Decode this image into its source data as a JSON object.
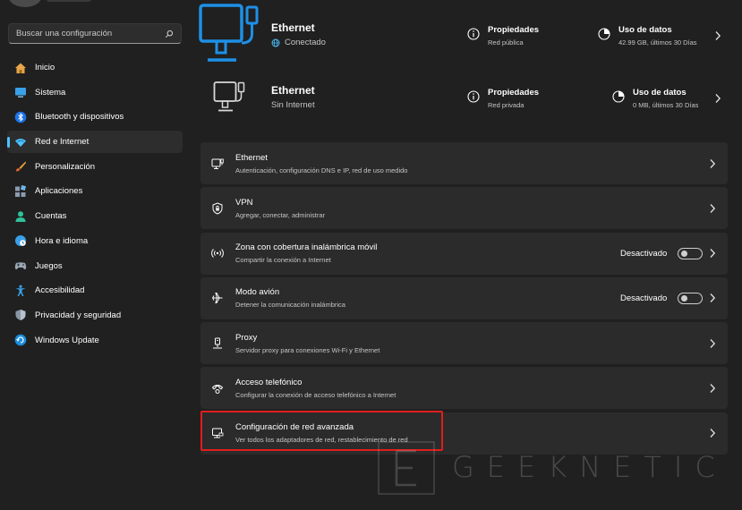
{
  "search": {
    "placeholder": "Buscar una configuración"
  },
  "sidebar": {
    "items": [
      {
        "label": "Inicio",
        "icon": "home-icon"
      },
      {
        "label": "Sistema",
        "icon": "system-icon"
      },
      {
        "label": "Bluetooth y dispositivos",
        "icon": "bluetooth-icon"
      },
      {
        "label": "Red e Internet",
        "icon": "network-icon",
        "active": true
      },
      {
        "label": "Personalización",
        "icon": "brush-icon"
      },
      {
        "label": "Aplicaciones",
        "icon": "apps-icon"
      },
      {
        "label": "Cuentas",
        "icon": "account-icon"
      },
      {
        "label": "Hora e idioma",
        "icon": "clock-globe-icon"
      },
      {
        "label": "Juegos",
        "icon": "gamepad-icon"
      },
      {
        "label": "Accesibilidad",
        "icon": "accessibility-icon"
      },
      {
        "label": "Privacidad y seguridad",
        "icon": "shield-icon"
      },
      {
        "label": "Windows Update",
        "icon": "update-icon"
      }
    ]
  },
  "networks": [
    {
      "name": "Ethernet",
      "status": "Conectado",
      "properties_title": "Propiedades",
      "properties_sub": "Red pública",
      "usage_title": "Uso de datos",
      "usage_sub": "42.99 GB, últimos 30 Días"
    },
    {
      "name": "Ethernet",
      "status": "Sin Internet",
      "properties_title": "Propiedades",
      "properties_sub": "Red privada",
      "usage_title": "Uso de datos",
      "usage_sub": "0 MB, últimos 30 Días"
    }
  ],
  "settings": [
    {
      "title": "Ethernet",
      "sub": "Autenticación, configuración DNS e IP, red de uso medido",
      "icon": "ethernet-icon"
    },
    {
      "title": "VPN",
      "sub": "Agregar, conectar, administrar",
      "icon": "vpn-shield-icon"
    },
    {
      "title": "Zona con cobertura inalámbrica móvil",
      "sub": "Compartir la conexión a Internet",
      "icon": "hotspot-icon",
      "toggle": "Desactivado"
    },
    {
      "title": "Modo avión",
      "sub": "Detener la comunicación inalámbrica",
      "icon": "airplane-icon",
      "toggle": "Desactivado"
    },
    {
      "title": "Proxy",
      "sub": "Servidor proxy para conexiones Wi-Fi y Ethernet",
      "icon": "proxy-icon"
    },
    {
      "title": "Acceso telefónico",
      "sub": "Configurar la conexión de acceso telefónico a Internet",
      "icon": "dialup-icon"
    },
    {
      "title": "Configuración de red avanzada",
      "sub": "Ver todos los adaptadores de red, restablecimiento de red",
      "icon": "advanced-network-icon"
    }
  ],
  "watermark": {
    "text": "GEEKNETIC"
  },
  "colors": {
    "accent": "#4cc2ff",
    "highlight": "#e11d1d",
    "background": "#202020",
    "card": "#2b2b2b"
  }
}
